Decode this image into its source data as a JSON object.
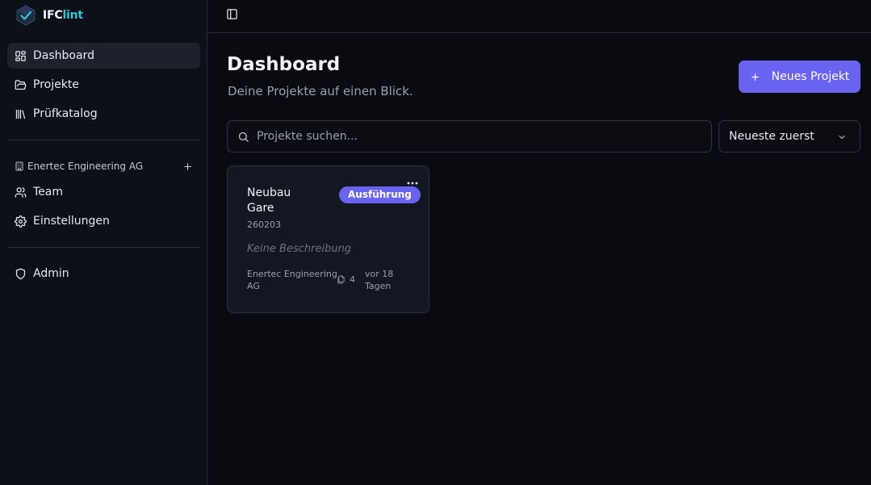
{
  "app": {
    "logo_part1": "IFC",
    "logo_part2": "lint",
    "accent": "#6a62f0",
    "brand_teal": "#2ec7d4"
  },
  "sidebar": {
    "main_items": [
      {
        "label": "Dashboard",
        "icon": "dashboard-icon",
        "active": true
      },
      {
        "label": "Projekte",
        "icon": "folder-open-icon",
        "active": false
      },
      {
        "label": "Prüfkatalog",
        "icon": "library-icon",
        "active": false
      }
    ],
    "org_label": "Enertec Engineering AG",
    "org_items": [
      {
        "label": "Team",
        "icon": "users-icon"
      },
      {
        "label": "Einstellungen",
        "icon": "gear-icon"
      }
    ],
    "admin_item": {
      "label": "Admin",
      "icon": "shield-icon"
    }
  },
  "main": {
    "title": "Dashboard",
    "subtitle": "Deine Projekte auf einen Blick.",
    "new_project_label": "Neues Projekt",
    "search_placeholder": "Projekte suchen...",
    "sort_selected": "Neueste zuerst"
  },
  "projects": [
    {
      "name": "Neubau Gare",
      "code": "260203",
      "status": "Ausführung",
      "description": "Keine Beschreibung",
      "organization": "Enertec Engineering AG",
      "file_count": "4",
      "updated": "vor 18 Tagen"
    }
  ]
}
